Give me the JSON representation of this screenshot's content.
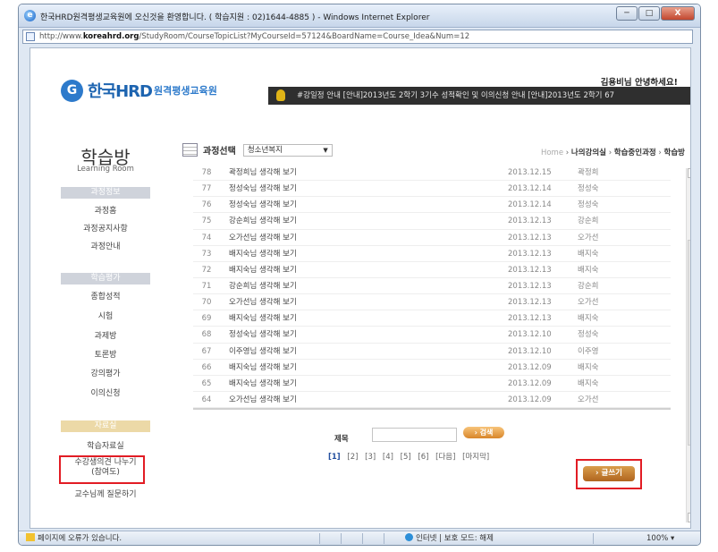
{
  "window": {
    "title": "한국HRD원격평생교육원에 오신것을 환영합니다. ( 학습지원 : 02)1644-4885 ) - Windows Internet Explorer",
    "url_prefix": "http://www.",
    "url_domain": "koreahrd.org",
    "url_path": "/StudyRoom/CourseTopicList?MyCourseId=57124&BoardName=Course_Idea&Num=12",
    "min": "─",
    "max": "□",
    "close": "X"
  },
  "header": {
    "logo_mark": "G",
    "logo_name": "한국HRD",
    "logo_sub": "원격평생교육원",
    "greeting": "김용비님 안녕하세요!",
    "ticker": "#강일정 안내   [안내]2013년도 2학기 3기수 성적확인 및 이의신청 안내   [안내]2013년도 2학기 67"
  },
  "sidebar": {
    "title": "학습방",
    "subtitle": "Learning Room",
    "section1": "과정정보",
    "items1": [
      "과정홈",
      "과정공지사항",
      "과정안내"
    ],
    "section2": "학습평가",
    "items2": [
      "종합성적",
      "시험",
      "과제방",
      "토론방",
      "강의평가",
      "이의신청"
    ],
    "section3": "자료실",
    "items3": [
      "학습자료실",
      "수강생의견 나누기",
      "(참여도)",
      "교수님께 질문하기"
    ]
  },
  "topic": {
    "label": "과정선택",
    "selected": "청소년복지",
    "arrow": "▼"
  },
  "breadcrumb": {
    "home": "Home",
    "sep": "›",
    "items": [
      "나의강의실",
      "학습중인과정",
      "학습방"
    ]
  },
  "posts": [
    {
      "num": "78",
      "title": "곽정희님 생각해 보기",
      "date": "2013.12.15",
      "author": "곽정희"
    },
    {
      "num": "77",
      "title": "정성숙님 생각해 보기",
      "date": "2013.12.14",
      "author": "정성숙"
    },
    {
      "num": "76",
      "title": "정성숙님 생각해 보기",
      "date": "2013.12.14",
      "author": "정성숙"
    },
    {
      "num": "75",
      "title": "강순희님 생각해 보기",
      "date": "2013.12.13",
      "author": "강순희"
    },
    {
      "num": "74",
      "title": "오가선님 생각해 보기",
      "date": "2013.12.13",
      "author": "오가선"
    },
    {
      "num": "73",
      "title": "배지숙님 생각해 보기",
      "date": "2013.12.13",
      "author": "배지숙"
    },
    {
      "num": "72",
      "title": "배지숙님 생각해 보기",
      "date": "2013.12.13",
      "author": "배지숙"
    },
    {
      "num": "71",
      "title": "강순희님 생각해 보기",
      "date": "2013.12.13",
      "author": "강순희"
    },
    {
      "num": "70",
      "title": "오가선님 생각해 보기",
      "date": "2013.12.13",
      "author": "오가선"
    },
    {
      "num": "69",
      "title": "배지숙님 생각해 보기",
      "date": "2013.12.13",
      "author": "배지숙"
    },
    {
      "num": "68",
      "title": "정성숙님 생각해 보기",
      "date": "2013.12.10",
      "author": "정성숙"
    },
    {
      "num": "67",
      "title": "이주영님 생각해 보기",
      "date": "2013.12.10",
      "author": "이주영"
    },
    {
      "num": "66",
      "title": "배지숙님 생각해 보기",
      "date": "2013.12.09",
      "author": "배지숙"
    },
    {
      "num": "65",
      "title": "배지숙님 생각해 보기",
      "date": "2013.12.09",
      "author": "배지숙"
    },
    {
      "num": "64",
      "title": "오가선님 생각해 보기",
      "date": "2013.12.09",
      "author": "오가선"
    }
  ],
  "search": {
    "label": "제목",
    "button": "› 검색"
  },
  "pager": [
    "[1]",
    "[2]",
    "[3]",
    "[4]",
    "[5]",
    "[6]",
    "[다음]",
    "[마지막]"
  ],
  "write_button": "› 글쓰기",
  "status": {
    "error": "페이지에 오류가 있습니다.",
    "zone": "인터넷 | 보호 모드: 해제",
    "zoom": "100%",
    "zoom_arrow": "▾"
  },
  "colors": {
    "highlight": "#e21c24",
    "accent": "#1d64b0",
    "button": "#d8862a"
  }
}
